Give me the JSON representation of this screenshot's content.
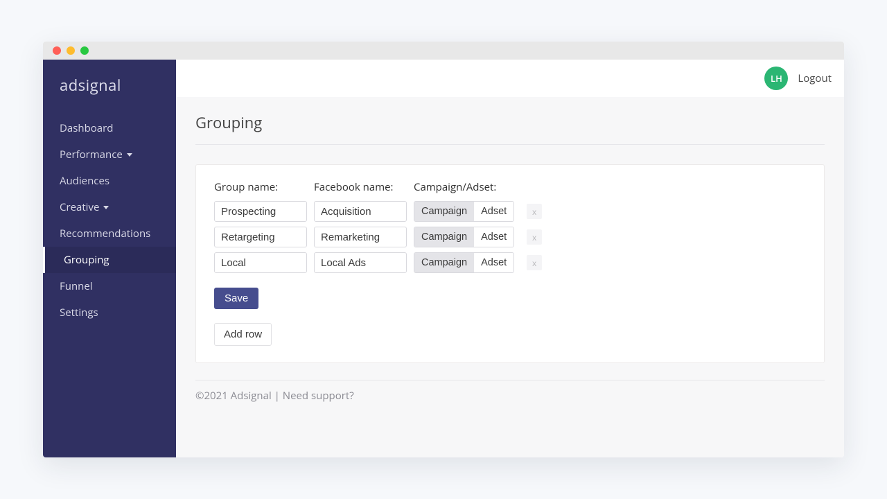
{
  "brand": "adsignal",
  "sidebar": {
    "items": [
      {
        "label": "Dashboard",
        "caret": false,
        "active": false
      },
      {
        "label": "Performance",
        "caret": true,
        "active": false
      },
      {
        "label": "Audiences",
        "caret": false,
        "active": false
      },
      {
        "label": "Creative",
        "caret": true,
        "active": false
      },
      {
        "label": "Recommendations",
        "caret": false,
        "active": false
      },
      {
        "label": "Grouping",
        "caret": false,
        "active": true
      },
      {
        "label": "Funnel",
        "caret": false,
        "active": false
      },
      {
        "label": "Settings",
        "caret": false,
        "active": false
      }
    ]
  },
  "header": {
    "avatar_initials": "LH",
    "logout_label": "Logout"
  },
  "page": {
    "title": "Grouping",
    "columns": {
      "group_name": "Group name:",
      "facebook_name": "Facebook name:",
      "campaign_adset": "Campaign/Adset:"
    },
    "rows": [
      {
        "group": "Prospecting",
        "facebook": "Acquisition",
        "type": "Campaign"
      },
      {
        "group": "Retargeting",
        "facebook": "Remarketing",
        "type": "Campaign"
      },
      {
        "group": "Local",
        "facebook": "Local Ads",
        "type": "Campaign"
      }
    ],
    "toggle_options": {
      "campaign": "Campaign",
      "adset": "Adset"
    },
    "delete_glyph": "x",
    "save_label": "Save",
    "add_row_label": "Add row"
  },
  "footer": {
    "copyright": "©2021 Adsignal",
    "sep": " | ",
    "support": "Need support?"
  }
}
